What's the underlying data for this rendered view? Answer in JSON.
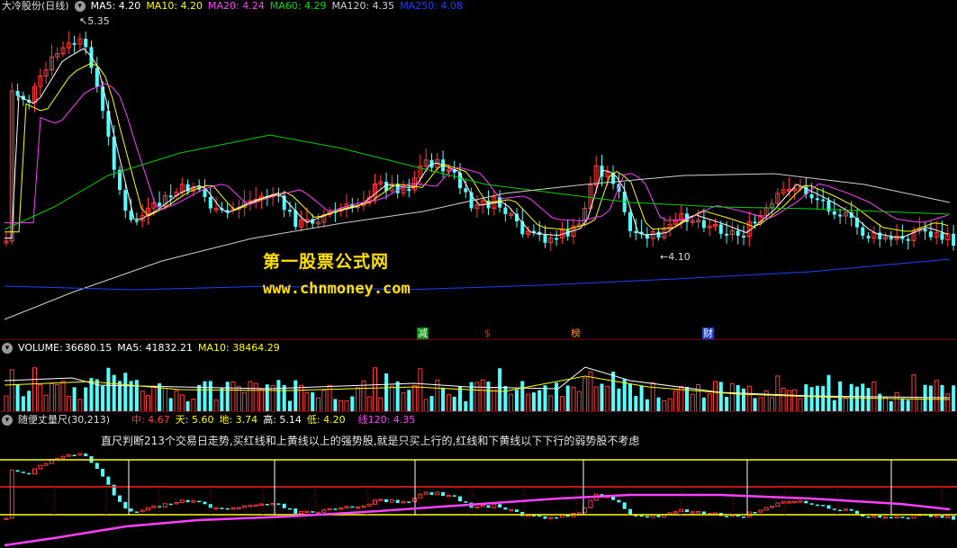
{
  "main": {
    "title": "大冷股份(日线)",
    "ma": [
      {
        "label": "MA5: 4.20",
        "color": "#ffffff"
      },
      {
        "label": "MA10: 4.20",
        "color": "#ffff00"
      },
      {
        "label": "MA20: 4.24",
        "color": "#ff40ff"
      },
      {
        "label": "MA60: 4.29",
        "color": "#00e000"
      },
      {
        "label": "MA120: 4.35",
        "color": "#d0d0d0"
      },
      {
        "label": "MA250: 4.08",
        "color": "#2040ff"
      }
    ],
    "high_label": "5.35",
    "low_label": "4.10",
    "markers": [
      {
        "text": "减",
        "color": "#00c000",
        "bg": "#00a000"
      },
      {
        "text": "$",
        "color": "#ff2020",
        "bg": ""
      },
      {
        "text": "榜",
        "color": "#ff9020",
        "bg": ""
      },
      {
        "text": "财",
        "color": "#ffffff",
        "bg": "#2040c0"
      }
    ],
    "watermark_cn": "第一股票公式网",
    "watermark_url": "www.chnmoney.com"
  },
  "volume": {
    "title": "VOLUME:",
    "value": "36680.15",
    "ma5": "MA5: 41832.21",
    "ma10": "MA10: 38464.29"
  },
  "ruler": {
    "title": "随便丈量尺(30,213)",
    "items": [
      {
        "label": "中: 4.67",
        "color": "#ff4040"
      },
      {
        "label": "天: 5.60",
        "color": "#ffff00"
      },
      {
        "label": "地: 3.74",
        "color": "#ffff00"
      },
      {
        "label": "高: 5.14",
        "color": "#ffffff"
      },
      {
        "label": "低: 4.20",
        "color": "#ffff00"
      },
      {
        "label": "线120: 4.35",
        "color": "#ff40ff"
      }
    ],
    "note": "直尺判断213个交易日走势,买红线和上黄线以上的强势股,就是只买上行的,红线和下黄线以下下行的弱势股不考虑"
  },
  "colors": {
    "up": "#ff3c3c",
    "down": "#54ffff",
    "grid": "#5a0000",
    "ma250": "#2040ff"
  }
}
